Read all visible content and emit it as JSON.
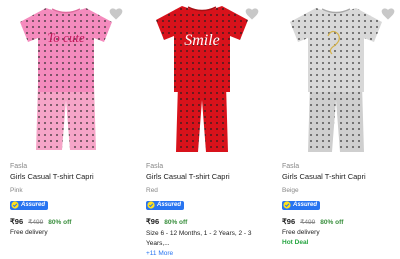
{
  "products": [
    {
      "brand": "Fasla",
      "title": "Girls Casual T-shirt Capri",
      "variant": "Pink",
      "assured_label": "Assured",
      "price": "₹96",
      "mrp": "₹499",
      "discount": "80% off",
      "delivery": "Free delivery",
      "graphic_text": "To cute",
      "colors": {
        "shirt": "#f48bbd",
        "pants": "#f6a5c8",
        "dots": "#2b2b2b",
        "text": "#c2185b"
      }
    },
    {
      "brand": "Fasla",
      "title": "Girls Casual T-shirt Capri",
      "variant": "Red",
      "assured_label": "Assured",
      "price": "₹96",
      "discount": "80% off",
      "sizes_text": "Size 6 - 12 Months, 1 - 2 Years, 2 - 3 Years,...",
      "more_sizes": "+11 More",
      "graphic_text": "Smile",
      "colors": {
        "shirt": "#d8121b",
        "pants": "#d8121b",
        "dots": "#1f1f1f",
        "text": "#ffffff"
      }
    },
    {
      "brand": "Fasla",
      "title": "Girls Casual T-shirt Capri",
      "variant": "Beige",
      "assured_label": "Assured",
      "price": "₹96",
      "mrp": "₹499",
      "discount": "80% off",
      "delivery": "Free delivery",
      "badge": "Hot Deal",
      "colors": {
        "shirt": "#d8d8d8",
        "pants": "#cfcfcf",
        "dots": "#2f2f2f",
        "text": "#d4b24a"
      }
    }
  ],
  "icons": {
    "wishlist": "heart-icon",
    "assured": "assured-check-icon"
  },
  "accent": "#2874f0",
  "discount_color": "#388e3c"
}
